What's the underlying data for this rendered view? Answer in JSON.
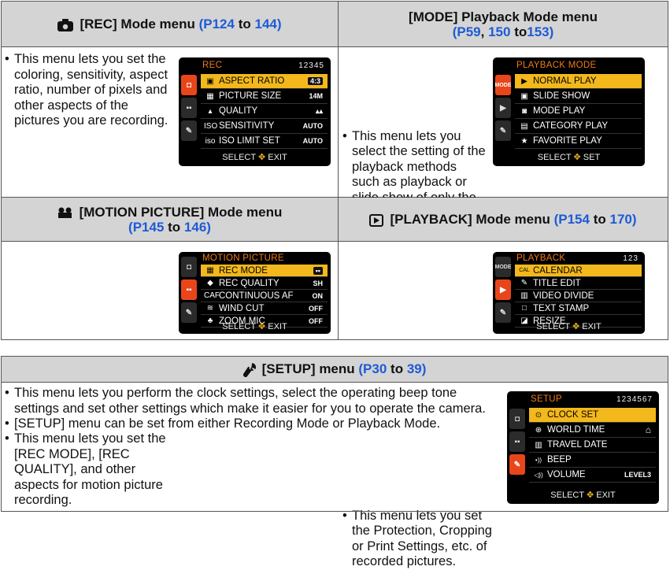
{
  "rec": {
    "header_label": "[REC] Mode menu",
    "header_ref_open": "(P124",
    "header_to": "to",
    "header_ref_close": "144)",
    "description": "This menu lets you set the coloring, sensitivity, aspect ratio, number of pixels and other aspects of the pictures you are recording.",
    "screen": {
      "title": "REC",
      "pages": "12345",
      "items": [
        {
          "icon": "aspect-icon",
          "glyph": "▣",
          "label": "ASPECT RATIO",
          "value": "4:3",
          "selected": true
        },
        {
          "icon": "picture-size-icon",
          "glyph": "▦",
          "label": "PICTURE SIZE",
          "value": "14M",
          "selected": false
        },
        {
          "icon": "quality-icon",
          "glyph": "▴",
          "label": "QUALITY",
          "value": "▴▴",
          "selected": false
        },
        {
          "icon": "iso-icon",
          "glyph": "ISO",
          "label": "SENSITIVITY",
          "value": "AUTO",
          "selected": false
        },
        {
          "icon": "iso-limit-icon",
          "glyph": "iso",
          "label": "ISO LIMIT SET",
          "value": "AUTO",
          "selected": false
        }
      ],
      "footer_left": "SELECT",
      "footer_right": "EXIT"
    }
  },
  "playback_mode": {
    "header_line1": "[MODE] Playback Mode menu",
    "header_ref1": "(P59",
    "header_sep": ",",
    "header_ref2": "150",
    "header_to": "to",
    "header_ref3": "153)",
    "description": "This menu lets you select the setting of the playback methods such as playback or slide show of only the pictures set as [FAVORITE].",
    "screen": {
      "title": "PLAYBACK MODE",
      "items": [
        {
          "icon": "normal-play-icon",
          "glyph": "▶",
          "label": "NORMAL PLAY",
          "selected": true
        },
        {
          "icon": "slide-show-icon",
          "glyph": "▣",
          "label": "SLIDE SHOW",
          "selected": false
        },
        {
          "icon": "mode-play-icon",
          "glyph": "◙",
          "label": "MODE PLAY",
          "selected": false
        },
        {
          "icon": "category-play-icon",
          "glyph": "▤",
          "label": "CATEGORY PLAY",
          "selected": false
        },
        {
          "icon": "favorite-icon",
          "glyph": "★",
          "label": "FAVORITE PLAY",
          "selected": false
        }
      ],
      "footer_left": "SELECT",
      "footer_right": "SET"
    }
  },
  "motion": {
    "header_label": "[MOTION PICTURE] Mode menu",
    "header_ref_open": "(P145",
    "header_to": "to",
    "header_ref_close": "146)",
    "description": "This menu lets you set the [REC MODE], [REC QUALITY], and other aspects for motion picture recording.",
    "screen": {
      "title": "MOTION PICTURE",
      "items": [
        {
          "icon": "rec-mode-icon",
          "glyph": "▦",
          "label": "REC MODE",
          "value": "▪▪",
          "selected": true
        },
        {
          "icon": "rec-quality-icon",
          "glyph": "◆",
          "label": "REC QUALITY",
          "value": "SH",
          "selected": false
        },
        {
          "icon": "continuous-af-icon",
          "glyph": "CAF",
          "label": "CONTINUOUS AF",
          "value": "ON",
          "selected": false
        },
        {
          "icon": "wind-cut-icon",
          "glyph": "≋",
          "label": "WIND CUT",
          "value": "OFF",
          "selected": false
        },
        {
          "icon": "zoom-mic-icon",
          "glyph": "♣",
          "label": "ZOOM MIC",
          "value": "OFF",
          "selected": false
        }
      ],
      "footer_left": "SELECT",
      "footer_right": "EXIT"
    }
  },
  "playback": {
    "header_label": "[PLAYBACK] Mode menu",
    "header_ref_open": "(P154",
    "header_to": "to",
    "header_ref_close": "170)",
    "description": "This menu lets you set the Protection, Cropping or Print Settings, etc. of recorded pictures.",
    "screen": {
      "title": "PLAYBACK",
      "pages": "123",
      "items": [
        {
          "icon": "calendar-icon",
          "glyph": "CAL",
          "label": "CALENDAR",
          "selected": true
        },
        {
          "icon": "title-edit-icon",
          "glyph": "✎",
          "label": "TITLE EDIT",
          "selected": false
        },
        {
          "icon": "video-divide-icon",
          "glyph": "▥",
          "label": "VIDEO DIVIDE",
          "selected": false
        },
        {
          "icon": "text-stamp-icon",
          "glyph": "□",
          "label": "TEXT STAMP",
          "selected": false
        },
        {
          "icon": "resize-icon",
          "glyph": "◪",
          "label": "RESIZE",
          "selected": false
        }
      ],
      "footer_left": "SELECT",
      "footer_right": "EXIT"
    }
  },
  "setup": {
    "header_label": "[SETUP] menu",
    "header_ref_open": "(P30",
    "header_to": "to",
    "header_ref_close": "39)",
    "bullets": [
      "This menu lets you perform the clock settings, select the operating beep tone settings and set other settings which make it easier for you to operate the camera.",
      "[SETUP] menu can be set from either Recording Mode or Playback Mode."
    ],
    "screen": {
      "title": "SETUP",
      "pages": "1234567",
      "items": [
        {
          "icon": "clock-icon",
          "glyph": "⊙",
          "label": "CLOCK SET",
          "value": "",
          "selected": true
        },
        {
          "icon": "world-time-icon",
          "glyph": "⊕",
          "label": "WORLD TIME",
          "value": "⌂",
          "selected": false
        },
        {
          "icon": "travel-date-icon",
          "glyph": "▥",
          "label": "TRAVEL DATE",
          "value": "",
          "selected": false
        },
        {
          "icon": "beep-icon",
          "glyph": "•))",
          "label": "BEEP",
          "value": "",
          "selected": false
        },
        {
          "icon": "volume-icon",
          "glyph": "◁))",
          "label": "VOLUME",
          "value": "LEVEL3",
          "selected": false
        }
      ],
      "footer_left": "SELECT",
      "footer_right": "EXIT"
    }
  },
  "side_tabs": [
    "REC",
    "MODE",
    "MOTION",
    "PLAY",
    "SETUP"
  ],
  "colors": {
    "reference_link": "#1e5bd6",
    "header_bg": "#d4d4d4",
    "lcd_highlight": "#f2b81c",
    "lcd_title": "#f07a1a"
  }
}
